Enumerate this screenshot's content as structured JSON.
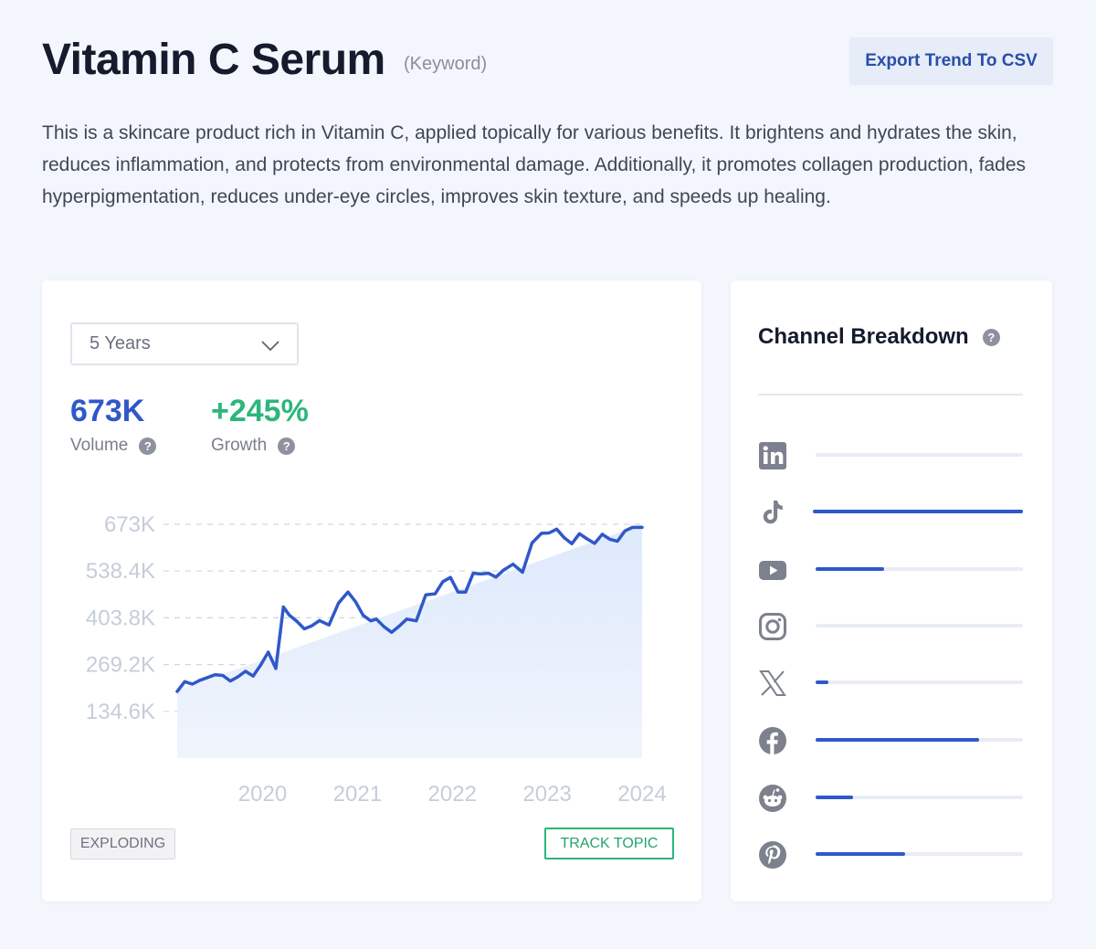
{
  "header": {
    "title": "Vitamin C Serum",
    "kind": "(Keyword)",
    "export_label": "Export Trend To CSV"
  },
  "description": "This is a skincare product rich in Vitamin C, applied topically for various benefits. It brightens and hydrates the skin, reduces inflammation, and protects from environmental damage. Additionally, it promotes collagen production, fades hyperpigmentation, reduces under-eye circles, improves skin texture, and speeds up healing.",
  "trend_card": {
    "timeframe": "5 Years",
    "volume": {
      "value": "673K",
      "label": "Volume"
    },
    "growth": {
      "value": "+245%",
      "label": "Growth"
    },
    "status_badge": "EXPLODING",
    "track_label": "TRACK TOPIC"
  },
  "colors": {
    "accent_blue": "#2f58c9",
    "growth_green": "#2bb67a",
    "area_fill": "#dce8fb"
  },
  "chart_data": {
    "type": "line",
    "x_tick_labels": [
      "2020",
      "2021",
      "2022",
      "2023",
      "2024"
    ],
    "y_tick_labels": [
      "673K",
      "538.4K",
      "403.8K",
      "269.2K",
      "134.6K"
    ],
    "y_ticks": [
      673000,
      538400,
      403800,
      269200,
      134600
    ],
    "ylim": [
      0,
      673000
    ],
    "xlim": [
      2019.1,
      2024.0
    ],
    "grid": "horizontal dashed",
    "series": [
      {
        "x": [
          2019.1,
          2019.18,
          2019.26,
          2019.34,
          2019.42,
          2019.5,
          2019.58,
          2019.66,
          2019.74,
          2019.82,
          2019.9,
          2019.98,
          2020.06,
          2020.14,
          2020.22,
          2020.28,
          2020.36,
          2020.44,
          2020.52,
          2020.6,
          2020.7,
          2020.8,
          2020.9,
          2020.98,
          2021.06,
          2021.14,
          2021.2,
          2021.28,
          2021.36,
          2021.44,
          2021.52,
          2021.62,
          2021.72,
          2021.82,
          2021.9,
          2021.98,
          2022.06,
          2022.14,
          2022.22,
          2022.3,
          2022.38,
          2022.46,
          2022.54,
          2022.64,
          2022.74,
          2022.84,
          2022.94,
          2023.02,
          2023.1,
          2023.18,
          2023.26,
          2023.34,
          2023.42,
          2023.5,
          2023.58,
          2023.66,
          2023.74,
          2023.82,
          2023.9,
          2024.0
        ],
        "y": [
          192000,
          220000,
          213000,
          224000,
          232000,
          240000,
          238000,
          222000,
          234000,
          250000,
          236000,
          268000,
          305000,
          258000,
          435000,
          412000,
          394000,
          372000,
          381000,
          396000,
          383000,
          446000,
          478000,
          450000,
          411000,
          395000,
          400000,
          378000,
          362000,
          380000,
          400000,
          395000,
          470000,
          473000,
          508000,
          520000,
          478000,
          478000,
          532000,
          530000,
          532000,
          521000,
          541000,
          558000,
          535000,
          619000,
          647000,
          648000,
          659000,
          634000,
          617000,
          646000,
          631000,
          618000,
          644000,
          630000,
          624000,
          654000,
          664000,
          664000
        ]
      }
    ],
    "trend_area": {
      "x": [
        2019.1,
        2024.0
      ],
      "y": [
        195000,
        673000
      ]
    }
  },
  "channels": {
    "title": "Channel Breakdown",
    "items": [
      {
        "icon": "linkedin-icon",
        "share": 0.0
      },
      {
        "icon": "tiktok-icon",
        "share": 1.0
      },
      {
        "icon": "youtube-icon",
        "share": 0.33
      },
      {
        "icon": "instagram-icon",
        "share": 0.0
      },
      {
        "icon": "x-icon",
        "share": 0.06
      },
      {
        "icon": "facebook-icon",
        "share": 0.79
      },
      {
        "icon": "reddit-icon",
        "share": 0.18
      },
      {
        "icon": "pinterest-icon",
        "share": 0.43
      }
    ]
  }
}
